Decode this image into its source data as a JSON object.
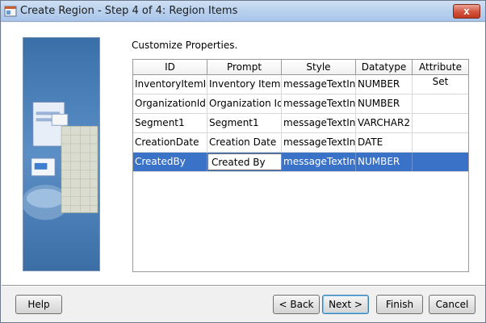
{
  "window": {
    "title": "Create Region - Step 4 of 4: Region Items",
    "close_label": "x"
  },
  "main": {
    "section_label": "Customize Properties."
  },
  "table": {
    "columns": [
      "ID",
      "Prompt",
      "Style",
      "Datatype",
      "Attribute Set"
    ],
    "rows": [
      {
        "id": "InventoryItemId",
        "prompt": "Inventory Item Id",
        "style": "messageTextIn...",
        "datatype": "NUMBER",
        "attribute_set": ""
      },
      {
        "id": "OrganizationId",
        "prompt": "Organization Id",
        "style": "messageTextIn...",
        "datatype": "NUMBER",
        "attribute_set": ""
      },
      {
        "id": "Segment1",
        "prompt": "Segment1",
        "style": "messageTextIn...",
        "datatype": "VARCHAR2",
        "attribute_set": ""
      },
      {
        "id": "CreationDate",
        "prompt": "Creation Date",
        "style": "messageTextIn...",
        "datatype": "DATE",
        "attribute_set": ""
      },
      {
        "id": "CreatedBy",
        "prompt": "Created By",
        "style": "messageTextIn...",
        "datatype": "NUMBER",
        "attribute_set": ""
      }
    ],
    "selected_row": 4
  },
  "buttons": {
    "help": "Help",
    "back": "< Back",
    "next": "Next >",
    "finish": "Finish",
    "cancel": "Cancel"
  },
  "colors": {
    "selection": "#3a72c7",
    "titlebar": "#b9d1ee",
    "close": "#d2533f"
  }
}
